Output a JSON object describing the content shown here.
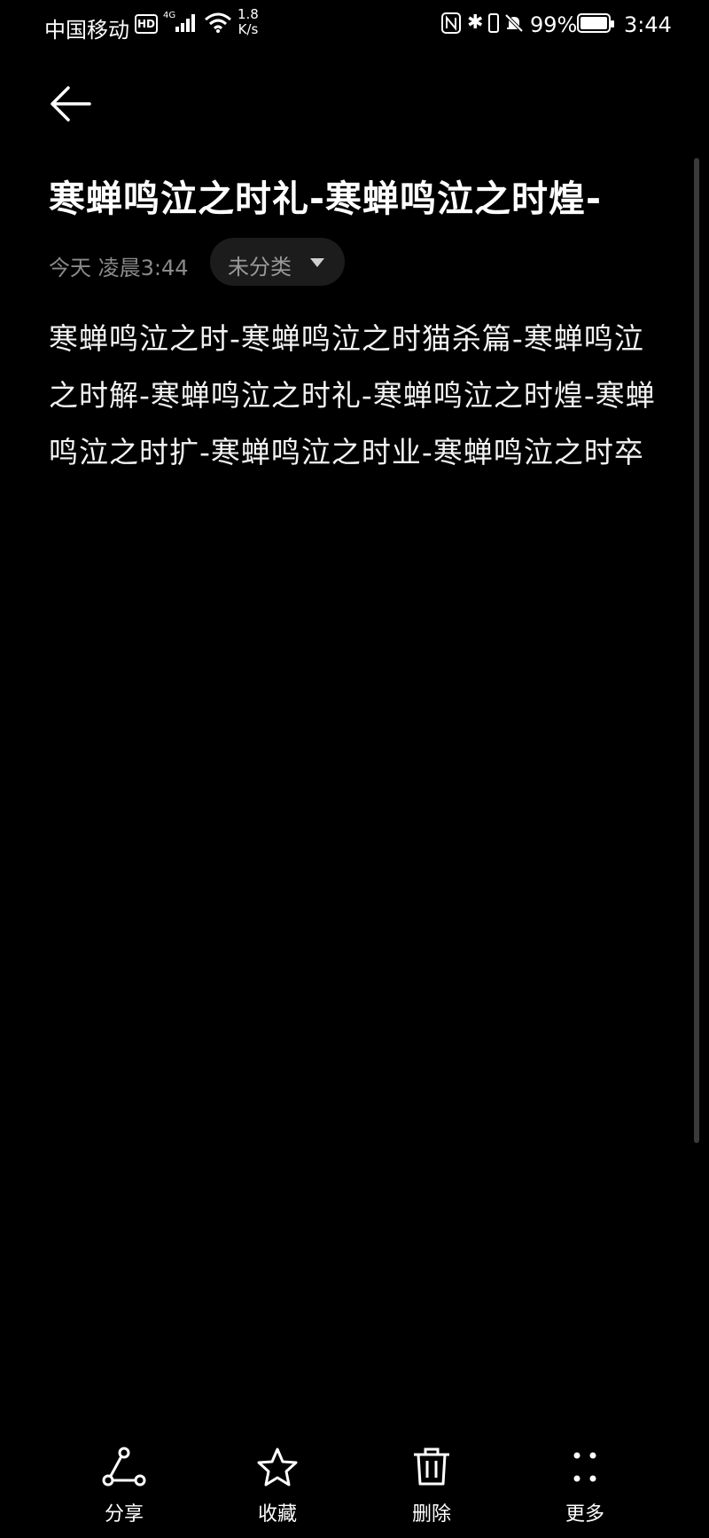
{
  "status_bar": {
    "carrier": "中国移动",
    "hd": "HD",
    "network": "4G",
    "speed_value": "1.8",
    "speed_unit": "K/s",
    "battery": "99%",
    "time": "3:44"
  },
  "note": {
    "title": "寒蝉鸣泣之时礼-寒蝉鸣泣之时煌-",
    "date": "今天 凌晨3:44",
    "category": "未分类",
    "body": "寒蝉鸣泣之时-寒蝉鸣泣之时猫杀篇-寒蝉鸣泣之时解-寒蝉鸣泣之时礼-寒蝉鸣泣之时煌-寒蝉鸣泣之时扩-寒蝉鸣泣之时业-寒蝉鸣泣之时卒"
  },
  "toolbar": {
    "share": "分享",
    "favorite": "收藏",
    "delete": "删除",
    "more": "更多"
  },
  "icons": [
    "back-arrow-icon",
    "dropdown-triangle-icon",
    "share-icon",
    "star-icon",
    "trash-icon",
    "more-dots-icon"
  ],
  "colors": {
    "background": "#000000",
    "text": "#ffffff",
    "muted": "#8a8a8a",
    "chip": "#1c1c1c"
  }
}
